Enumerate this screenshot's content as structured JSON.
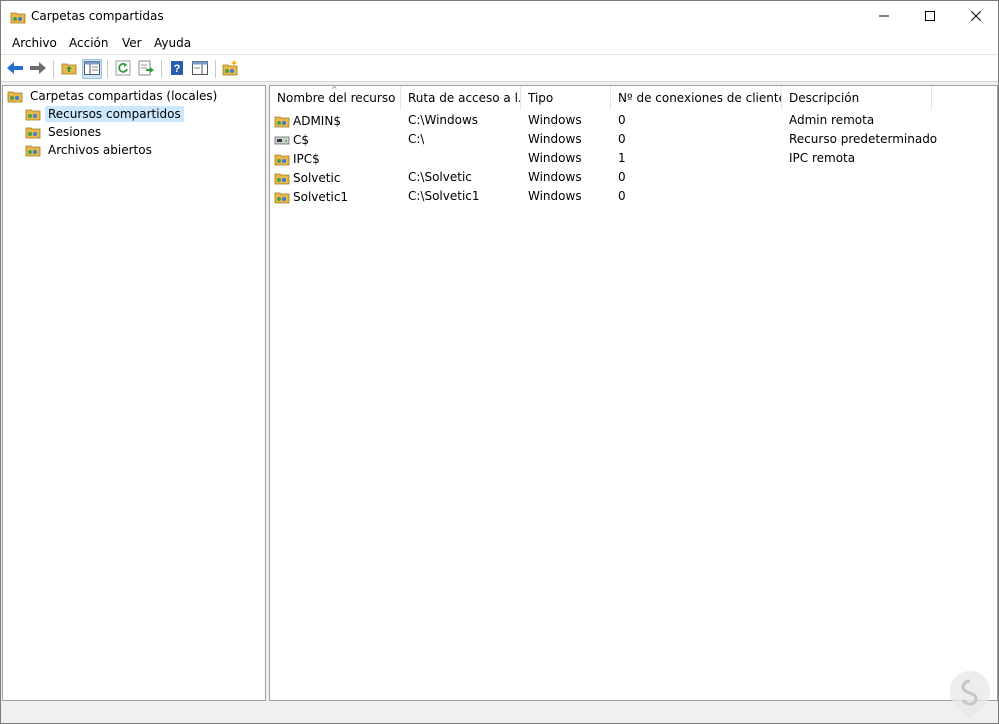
{
  "window": {
    "title": "Carpetas compartidas"
  },
  "menu": {
    "items": [
      "Archivo",
      "Acción",
      "Ver",
      "Ayuda"
    ]
  },
  "toolbar": {
    "icons": [
      "back-arrow-icon",
      "forward-arrow-icon",
      "up-folder-icon",
      "show-hide-tree-icon",
      "refresh-icon",
      "export-list-icon",
      "help-icon",
      "properties-pane-icon",
      "new-share-icon"
    ]
  },
  "tree": {
    "root": "Carpetas compartidas (locales)",
    "children": [
      "Recursos compartidos",
      "Sesiones",
      "Archivos abiertos"
    ],
    "selected": "Recursos compartidos"
  },
  "list": {
    "columns": [
      "Nombre del recurso",
      "Ruta de acceso a l...",
      "Tipo",
      "Nº de conexiones de cliente",
      "Descripción"
    ],
    "rows": [
      {
        "name": "ADMIN$",
        "path": "C:\\Windows",
        "type": "Windows",
        "connections": "0",
        "description": "Admin remota"
      },
      {
        "name": "C$",
        "path": "C:\\",
        "type": "Windows",
        "connections": "0",
        "description": "Recurso predeterminado"
      },
      {
        "name": "IPC$",
        "path": "",
        "type": "Windows",
        "connections": "1",
        "description": "IPC remota"
      },
      {
        "name": "Solvetic",
        "path": "C:\\Solvetic",
        "type": "Windows",
        "connections": "0",
        "description": ""
      },
      {
        "name": "Solvetic1",
        "path": "C:\\Solvetic1",
        "type": "Windows",
        "connections": "0",
        "description": ""
      }
    ]
  },
  "colors": {
    "selection": "#cce8ff",
    "toolbar_active": "#cce4f7",
    "arrow_blue": "#1f6fd1"
  }
}
